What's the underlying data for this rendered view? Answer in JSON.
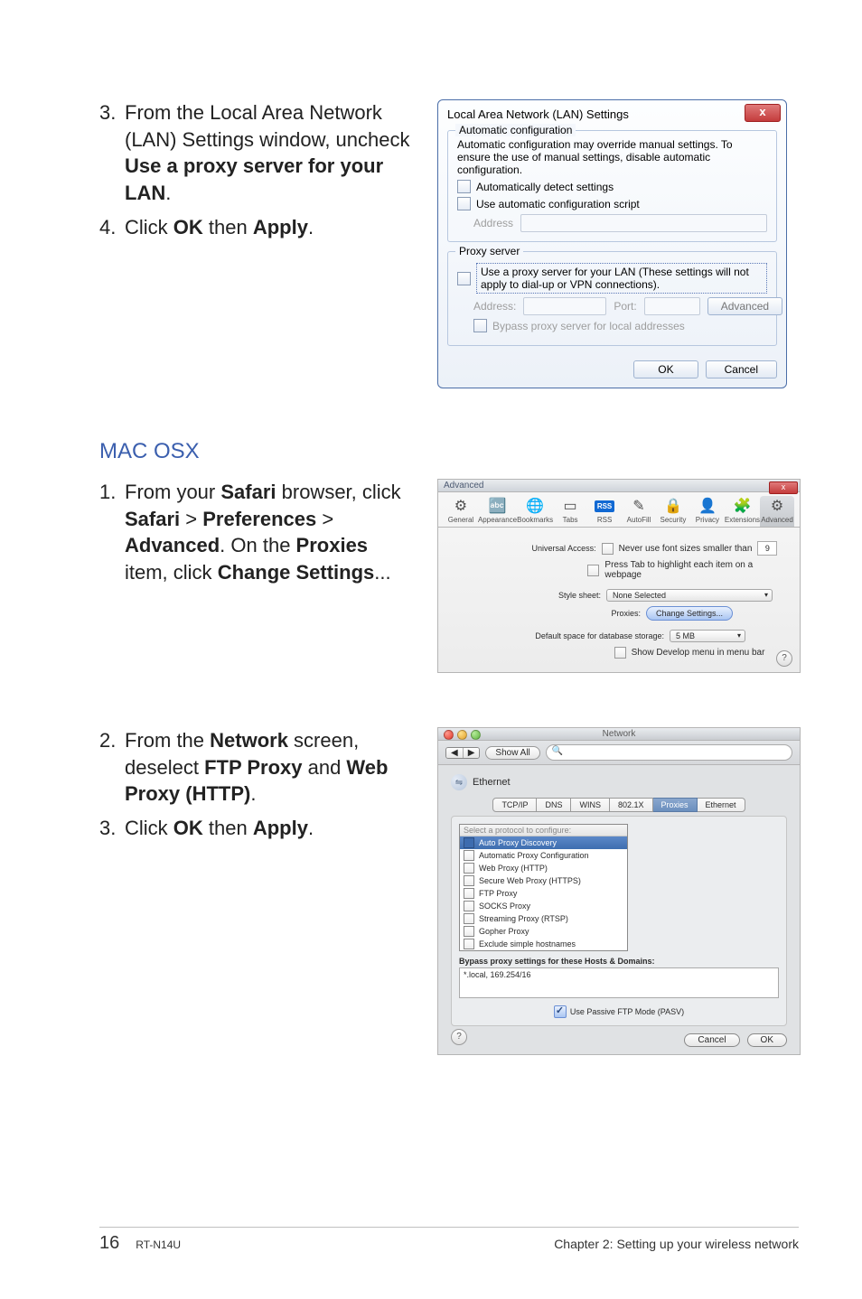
{
  "sections": {
    "first": [
      {
        "num": "3",
        "html": "From the Local Area Network (LAN) Settings window, uncheck <b>Use a proxy server for your LAN</b>."
      },
      {
        "num": "4",
        "html": "Click <b>OK</b> then <b>Apply</b>."
      }
    ],
    "mac_heading": "MAC OSX",
    "mac1": [
      {
        "num": "1",
        "html": "From your <b>Safari</b> browser, click <b>Safari</b> > <b>Preferences</b> > <b>Advanced</b>. On the <b>Proxies</b> item, click <b>Change Settings</b>..."
      }
    ],
    "mac2": [
      {
        "num": "2",
        "html": "From the <b>Network</b> screen, deselect <b>FTP Proxy</b> and <b>Web Proxy (HTTP)</b>."
      },
      {
        "num": "3",
        "html": "Click <b>OK</b> then <b>Apply</b>."
      }
    ]
  },
  "win_dialog": {
    "title": "Local Area Network (LAN) Settings",
    "close": "x",
    "auto_legend": "Automatic configuration",
    "auto_note": "Automatic configuration may override manual settings. To ensure the use of manual settings, disable automatic configuration.",
    "auto_detect": "Automatically detect settings",
    "auto_script": "Use automatic configuration script",
    "address_lbl": "Address",
    "proxy_legend": "Proxy server",
    "proxy_use": "Use a proxy server for your LAN (These settings will not apply to dial-up or VPN connections).",
    "p_address": "Address:",
    "p_port": "Port:",
    "advanced": "Advanced",
    "bypass": "Bypass proxy server for local addresses",
    "ok": "OK",
    "cancel": "Cancel"
  },
  "safari": {
    "title": "Advanced",
    "close": "x",
    "tabs": [
      "General",
      "Appearance",
      "Bookmarks",
      "Tabs",
      "RSS",
      "AutoFill",
      "Security",
      "Privacy",
      "Extensions",
      "Advanced"
    ],
    "ua_label": "Universal Access:",
    "ua1": "Never use font sizes smaller than",
    "ua_val": "9",
    "ua2": "Press Tab to highlight each item on a webpage",
    "ss_label": "Style sheet:",
    "ss_val": "None Selected",
    "proxies_label": "Proxies:",
    "proxies_btn": "Change Settings...",
    "db_label": "Default space for database storage:",
    "db_val": "5 MB",
    "dev": "Show Develop menu in menu bar"
  },
  "network": {
    "title": "Network",
    "show_all": "Show All",
    "ethernet": "Ethernet",
    "tabs": [
      "TCP/IP",
      "DNS",
      "WINS",
      "802.1X",
      "Proxies",
      "Ethernet"
    ],
    "proto_hdr": "Select a protocol to configure:",
    "protos": [
      {
        "label": "Auto Proxy Discovery",
        "sel": true
      },
      {
        "label": "Automatic Proxy Configuration",
        "sel": false
      },
      {
        "label": "Web Proxy (HTTP)",
        "sel": false
      },
      {
        "label": "Secure Web Proxy (HTTPS)",
        "sel": false
      },
      {
        "label": "FTP Proxy",
        "sel": false
      },
      {
        "label": "SOCKS Proxy",
        "sel": false
      },
      {
        "label": "Streaming Proxy (RTSP)",
        "sel": false
      },
      {
        "label": "Gopher Proxy",
        "sel": false
      }
    ],
    "exclude": "Exclude simple hostnames",
    "bypass_label": "Bypass proxy settings for these Hosts & Domains:",
    "bypass_val": "*.local, 169.254/16",
    "pasv": "Use Passive FTP Mode (PASV)",
    "cancel": "Cancel",
    "ok": "OK"
  },
  "footer": {
    "page": "16",
    "model": "RT-N14U",
    "chapter": "Chapter 2: Setting up your wireless network"
  }
}
